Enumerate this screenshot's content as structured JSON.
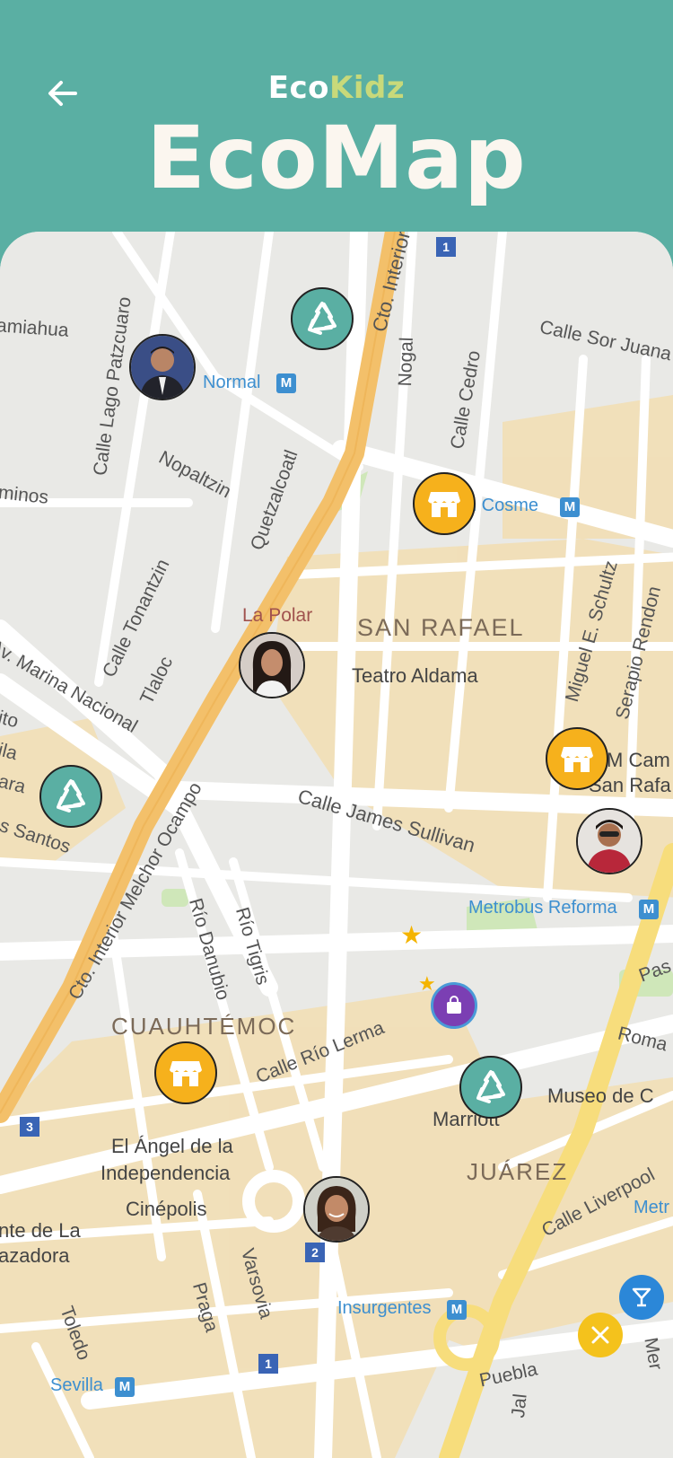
{
  "header": {
    "brand_eco": "Eco",
    "brand_kidz": "Kidz",
    "title": "EcoMap"
  },
  "map": {
    "streets": {
      "amiahua": "amiahua",
      "lago_patzcuaro": "Calle Lago Patzcuaro",
      "normal": "Normal",
      "cto_interior_top": "Cto. Interior",
      "nogal": "Nogal",
      "cedro": "Calle Cedro",
      "sor_juana": "Calle Sor Juana",
      "minos": "minos",
      "nopaltzin": "Nopaltzin",
      "quetzalcoatl": "Quetzalcoatl",
      "san_cosme": "n Cosme",
      "tonantzin": "Calle Tonantzin",
      "tlaloc": "Tlaloc",
      "la_polar": "La Polar",
      "san_rafael": "SAN RAFAEL",
      "teatro_aldama": "Teatro Aldama",
      "miguel_schultz": "Miguel E. Schultz",
      "serapio_rendon": "Serapio Rendon",
      "marina_nacional": "Av. Marina Nacional",
      "cto_melchor": "Cto. Interior Melchor Ocampo",
      "m_cam": "M Cam",
      "san_rafa": "San Rafa",
      "ito": "ito",
      "ila": "ila",
      "ara": "ara",
      "santos": "s Santos",
      "james_sullivan": "Calle James Sullivan",
      "metrobus_reforma": "Metrobus Reforma",
      "rio_danubio": "Río Danubio",
      "rio_tigris": "Río Tigris",
      "pas": "Pas",
      "roma": "Roma",
      "cuauhtemoc": "CUAUHTÉMOC",
      "rio_lerma": "Calle Río Lerma",
      "museo": "Museo de C",
      "marriott": "Marriott",
      "angel_1": "El Ángel de la",
      "angel_2": "Independencia",
      "juarez": "JUÁREZ",
      "cinepolis": "Cinépolis",
      "liverpool": "Calle Liverpool",
      "metr": "Metr",
      "nte_de_la": "nte de La",
      "azadora": "azadora",
      "varsovia": "Varsovia",
      "praga": "Praga",
      "insurgentes": "Insurgentes",
      "toledo": "Toledo",
      "puebla": "Puebla",
      "sevilla": "Sevilla",
      "jal": "Jal",
      "mer": "Mer"
    },
    "badges": {
      "b1_top": "1",
      "b3": "3",
      "b2": "2",
      "b1_bottom": "1"
    },
    "pins": [
      {
        "type": "recycle",
        "icon": "recycle-icon"
      },
      {
        "type": "user",
        "icon": "avatar"
      },
      {
        "type": "store",
        "icon": "store-icon"
      },
      {
        "type": "user",
        "icon": "avatar"
      },
      {
        "type": "store",
        "icon": "store-icon"
      },
      {
        "type": "recycle",
        "icon": "recycle-icon"
      },
      {
        "type": "user",
        "icon": "avatar"
      },
      {
        "type": "store",
        "icon": "store-icon"
      },
      {
        "type": "recycle",
        "icon": "recycle-icon"
      },
      {
        "type": "user",
        "icon": "avatar"
      }
    ]
  },
  "colors": {
    "teal": "#5aafa3",
    "store_yellow": "#f6b11c",
    "title_cream": "#fbf6ef",
    "kidz_green": "#c8d97a",
    "road_orange": "#f3c06a",
    "road_yellow": "#f7dd7c",
    "block_tan": "#f2dfb5",
    "metro_blue": "#3d8fd0"
  }
}
